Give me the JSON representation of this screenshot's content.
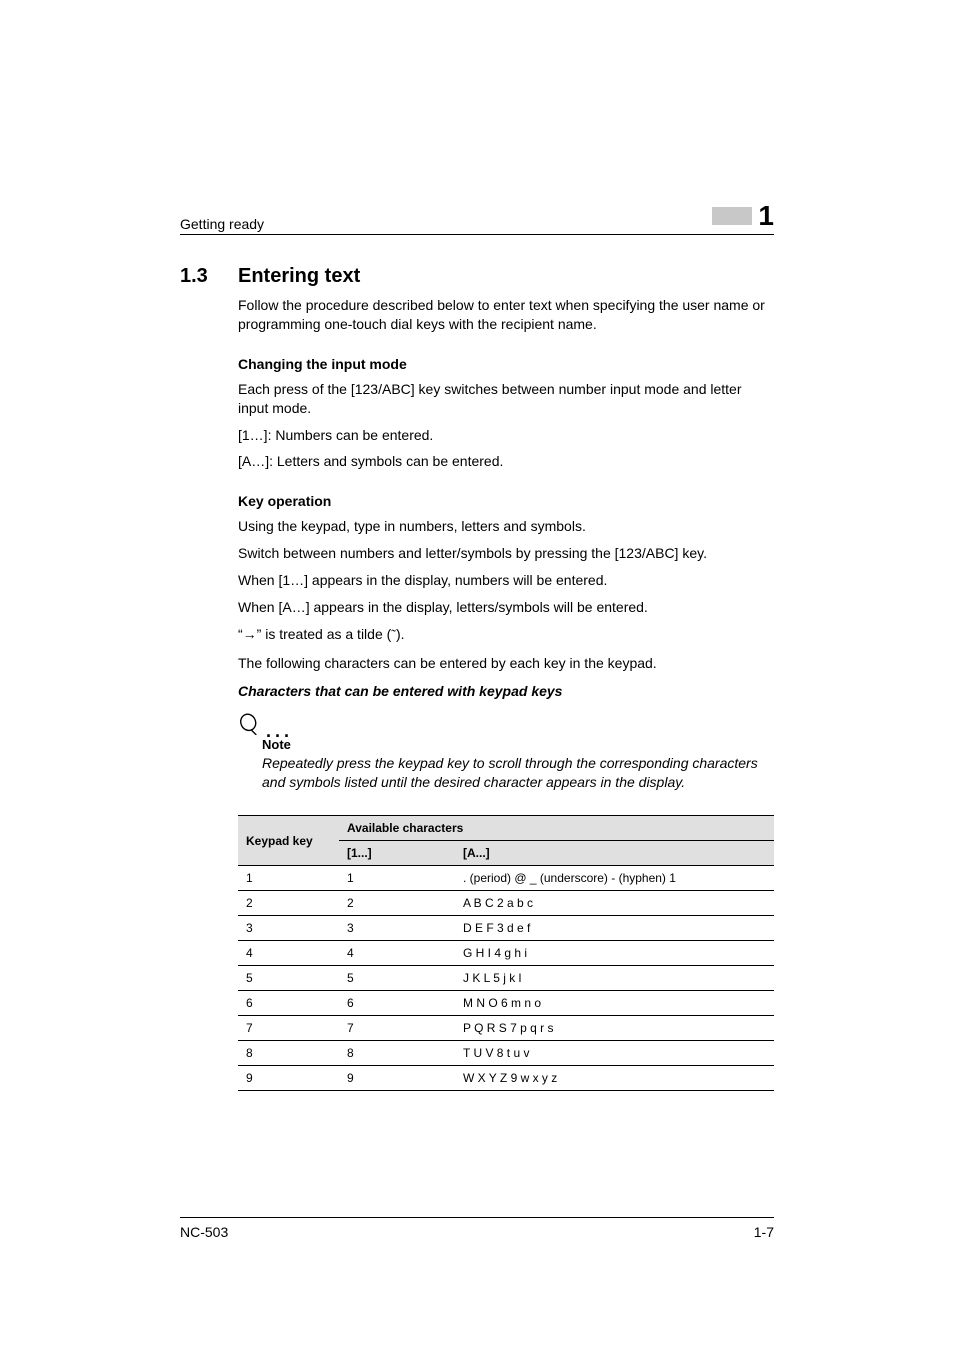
{
  "header": {
    "left": "Getting ready",
    "chapter_number": "1"
  },
  "section": {
    "number": "1.3",
    "title": "Entering text"
  },
  "intro": "Follow the procedure described below to enter text when specifying the user name or programming one-touch dial keys with the recipient name.",
  "change_mode": {
    "heading": "Changing the input mode",
    "p1": "Each press of the [123/ABC] key switches between number input mode and letter input mode.",
    "p2": "[1…]: Numbers can be entered.",
    "p3": "[A…]: Letters and symbols can be entered."
  },
  "key_op": {
    "heading": "Key operation",
    "p1": "Using the keypad, type in numbers, letters and symbols.",
    "p2": "Switch between numbers and letter/symbols by pressing the [123/ABC] key.",
    "p3": "When [1…] appears in the display, numbers will be entered.",
    "p4": "When [A…] appears in the display, letters/symbols will be entered.",
    "p5_pre": "“",
    "p5_arrow": "→",
    "p5_mid": "” is treated as a tilde (",
    "p5_tilde": "˜",
    "p5_post": ").",
    "p6": "The following characters can be entered by each key in the keypad.",
    "subheading": "Characters that can be entered with keypad keys"
  },
  "note": {
    "label": "Note",
    "text": "Repeatedly press the keypad key to scroll through the corresponding characters and symbols listed until the desired character appears in the display."
  },
  "table": {
    "col0": "Keypad key",
    "col1": "Available characters",
    "col1a": "[1...]",
    "col1b": "[A...]",
    "rows": [
      {
        "k": "1",
        "n": "1",
        "a": ". (period) @ _ (underscore) - (hyphen) 1"
      },
      {
        "k": "2",
        "n": "2",
        "a": "A B C 2 a b c"
      },
      {
        "k": "3",
        "n": "3",
        "a": "D E F 3 d e f"
      },
      {
        "k": "4",
        "n": "4",
        "a": "G H I 4 g h i"
      },
      {
        "k": "5",
        "n": "5",
        "a": "J K L 5 j k l"
      },
      {
        "k": "6",
        "n": "6",
        "a": "M N O 6 m n o"
      },
      {
        "k": "7",
        "n": "7",
        "a": "P Q R S 7 p q r s"
      },
      {
        "k": "8",
        "n": "8",
        "a": "T U V 8 t u v"
      },
      {
        "k": "9",
        "n": "9",
        "a": "W X Y Z 9 w x y z"
      }
    ]
  },
  "footer": {
    "left": "NC-503",
    "right": "1-7"
  }
}
